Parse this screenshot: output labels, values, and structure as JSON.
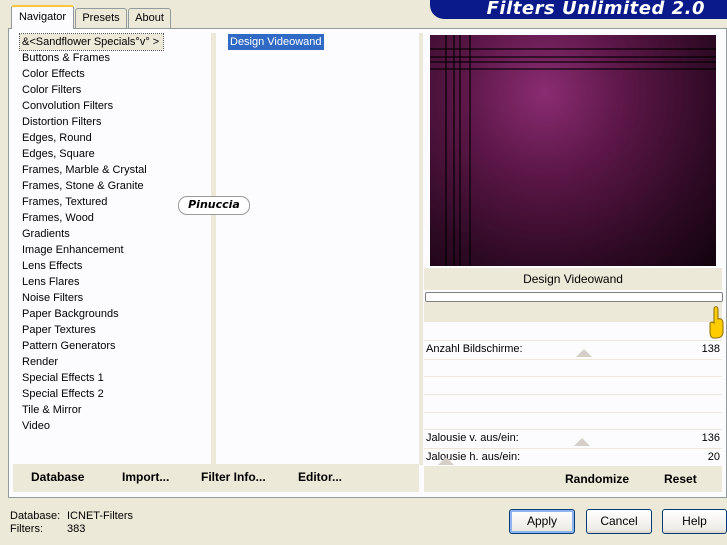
{
  "banner": {
    "title": "Filters Unlimited 2.0"
  },
  "tabs": [
    {
      "label": "Navigator",
      "active": true
    },
    {
      "label": "Presets",
      "active": false
    },
    {
      "label": "About",
      "active": false
    }
  ],
  "categories": [
    "&<Sandflower Specials°v° >",
    "Buttons & Frames",
    "Color Effects",
    "Color Filters",
    "Convolution Filters",
    "Distortion Filters",
    "Edges, Round",
    "Edges, Square",
    "Frames, Marble & Crystal",
    "Frames, Stone & Granite",
    "Frames, Textured",
    "Frames, Wood",
    "Gradients",
    "Image Enhancement",
    "Lens Effects",
    "Lens Flares",
    "Noise Filters",
    "Paper Backgrounds",
    "Paper Textures",
    "Pattern Generators",
    "Render",
    "Special Effects 1",
    "Special Effects 2",
    "Tile & Mirror",
    "Video"
  ],
  "filters": [
    "Design Videowand"
  ],
  "watermark": "Pinuccia",
  "bottom_buttons": {
    "database": "Database",
    "import": "Import...",
    "filter_info": "Filter Info...",
    "editor": "Editor..."
  },
  "preview": {
    "filter_name": "Design Videowand"
  },
  "params": [
    {
      "label": "Anzahl Bildschirme:",
      "value": "138"
    },
    {
      "label": "Jalousie v. aus/ein:",
      "value": "136"
    },
    {
      "label": "Jalousie h. aus/ein:",
      "value": "20"
    }
  ],
  "actions": {
    "randomize": "Randomize",
    "reset": "Reset"
  },
  "status": {
    "database_label": "Database:",
    "database_value": "ICNET-Filters",
    "filters_label": "Filters:",
    "filters_value": "383"
  },
  "dialog_buttons": {
    "apply": "Apply",
    "cancel": "Cancel",
    "help": "Help"
  },
  "colors": {
    "banner": "#0a1a8a",
    "selection": "#316ac5",
    "tab_highlight": "#ffc83c",
    "preview_tone": "#5a1646"
  }
}
